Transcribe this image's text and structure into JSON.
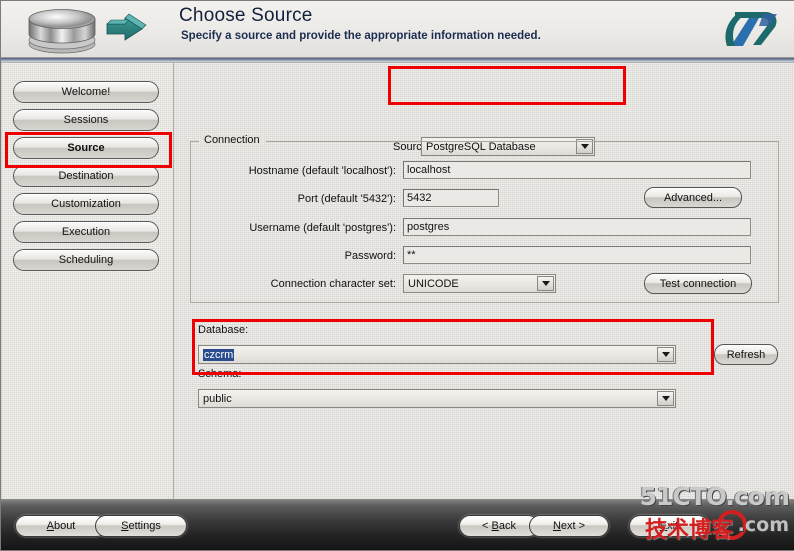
{
  "header": {
    "title": "Choose Source",
    "subtitle": "Specify a source and provide the appropriate information needed.",
    "icon": "database-cylinder-arrow-icon",
    "logo": "company-logo"
  },
  "sidebar": {
    "items": [
      {
        "label": "Welcome!",
        "selected": false
      },
      {
        "label": "Sessions",
        "selected": false
      },
      {
        "label": "Source",
        "selected": true
      },
      {
        "label": "Destination",
        "selected": false
      },
      {
        "label": "Customization",
        "selected": false
      },
      {
        "label": "Execution",
        "selected": false
      },
      {
        "label": "Scheduling",
        "selected": false
      }
    ]
  },
  "main": {
    "source": {
      "label": "Source:",
      "value": "PostgreSQL Database"
    },
    "connection": {
      "legend": "Connection",
      "fields": [
        {
          "label": "Hostname (default 'localhost'):",
          "value": "localhost"
        },
        {
          "label": "Port (default '5432'):",
          "value": "5432"
        },
        {
          "label": "Username (default 'postgres'):",
          "value": "postgres"
        },
        {
          "label": "Password:",
          "value": "**"
        }
      ],
      "charset_label": "Connection character set:",
      "charset_value": "UNICODE",
      "advanced_button": "Advanced...",
      "test_button": "Test connection"
    },
    "database": {
      "label": "Database:",
      "value": "czcrm",
      "refresh_button": "Refresh"
    },
    "schema": {
      "label": "Schema:",
      "value": "public"
    }
  },
  "footer": {
    "about": {
      "pre": "",
      "mnemonic": "A",
      "post": "bout"
    },
    "settings": {
      "pre": "",
      "mnemonic": "S",
      "post": "ettings"
    },
    "back": {
      "pre": "< ",
      "mnemonic": "B",
      "post": "ack"
    },
    "next": {
      "pre": "",
      "mnemonic": "N",
      "post": "ext >"
    },
    "exit": {
      "pre": "",
      "mnemonic": "E",
      "post": "xit"
    }
  },
  "watermark": {
    "top": "51CTO.com",
    "chinese": "技术博客",
    "blog": ".com",
    "blog_small": "Blog"
  },
  "colors": {
    "accent_red": "#ee0000",
    "title_blue": "#14213d",
    "selection_blue": "#2a4b8d"
  }
}
